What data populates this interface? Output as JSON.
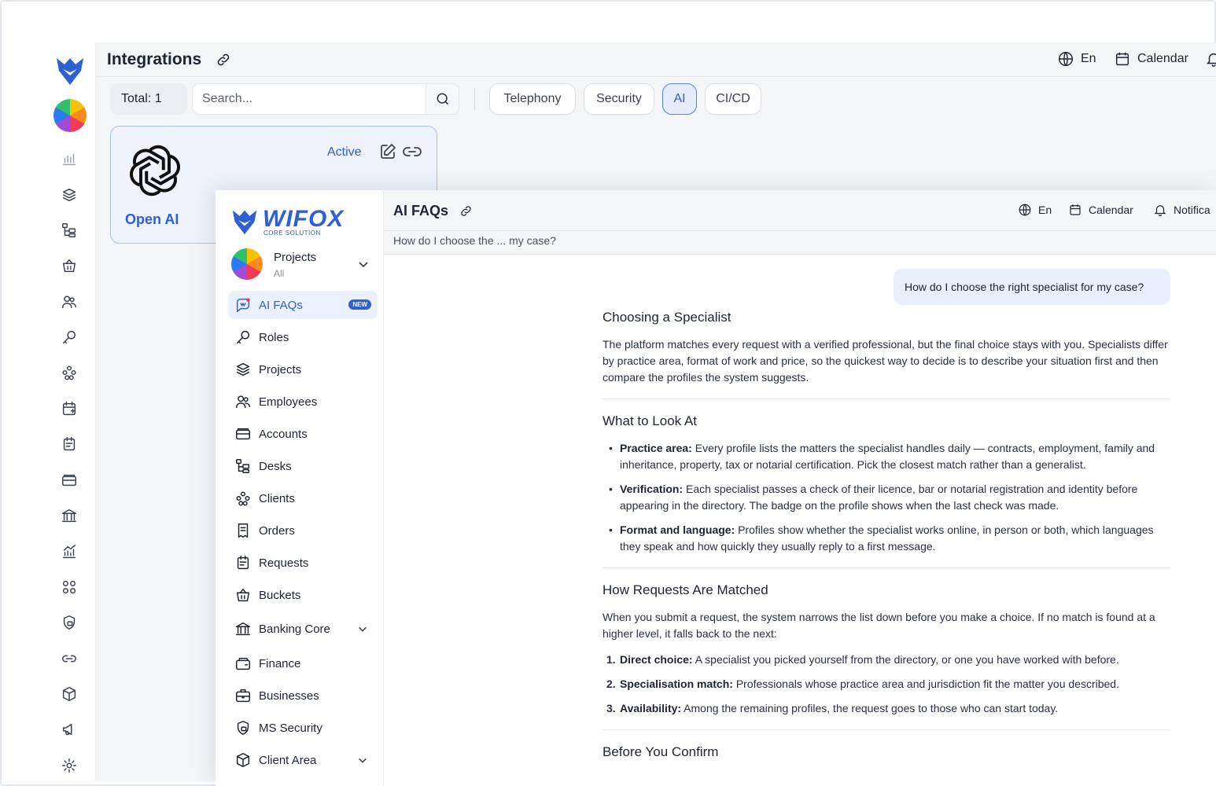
{
  "back": {
    "title": "Integrations",
    "header": {
      "language": "En",
      "calendar": "Calendar"
    },
    "toolbar": {
      "total": "Total: 1",
      "search_placeholder": "Search...",
      "filters": [
        "Telephony",
        "Security",
        "AI",
        "CI/CD"
      ],
      "active_filter": "AI"
    },
    "card": {
      "name": "Open AI",
      "status": "Active"
    }
  },
  "front": {
    "brand": {
      "name": "WIFOX",
      "sub": "CORE SOLUTION"
    },
    "project": {
      "title": "Projects",
      "sub": "All"
    },
    "nav": [
      {
        "label": "AI FAQs",
        "icon": "ai-chat-icon",
        "badge": "NEW",
        "active": true
      },
      {
        "label": "Roles",
        "icon": "key-icon"
      },
      {
        "label": "Projects",
        "icon": "layers-icon"
      },
      {
        "label": "Employees",
        "icon": "users-icon"
      },
      {
        "label": "Accounts",
        "icon": "wallet-icon"
      },
      {
        "label": "Desks",
        "icon": "hierarchy-icon"
      },
      {
        "label": "Clients",
        "icon": "clients-icon"
      },
      {
        "label": "Orders",
        "icon": "orders-icon"
      },
      {
        "label": "Requests",
        "icon": "requests-icon"
      },
      {
        "label": "Buckets",
        "icon": "basket-icon"
      },
      {
        "label": "Banking Core",
        "icon": "bank-icon",
        "expandable": true
      },
      {
        "label": "Finance",
        "icon": "finance-icon"
      },
      {
        "label": "Businesses",
        "icon": "business-icon"
      },
      {
        "label": "MS Security",
        "icon": "shield-lock-icon"
      },
      {
        "label": "Client Area",
        "icon": "box-icon",
        "expandable": true
      }
    ],
    "header": {
      "title": "AI FAQs",
      "language": "En",
      "calendar": "Calendar",
      "notifications": "Notifica"
    },
    "subtitle": "How do I choose the ... my case?",
    "chat": {
      "question": "How do I choose the right specialist for my case?",
      "sections": {
        "s1": {
          "heading": "Choosing a Specialist",
          "body": "The platform matches every request with a verified professional, but the final choice stays with you. Specialists differ by practice area, format of work and price, so the quickest way to decide is to describe your situation first and then compare the profiles the system suggests."
        },
        "s2": {
          "heading": "What to Look At",
          "items": [
            {
              "term": "Practice area:",
              "text": " Every profile lists the matters the specialist handles daily — contracts, employment, family and inheritance, property, tax or notarial certification. Pick the closest match rather than a generalist."
            },
            {
              "term": "Verification:",
              "text": " Each specialist passes a check of their licence, bar or notarial registration and identity before appearing in the directory. The badge on the profile shows when the last check was made."
            },
            {
              "term": "Format and language:",
              "text": " Profiles show whether the specialist works online, in person or both, which languages they speak and how quickly they usually reply to a first message."
            }
          ]
        },
        "s3": {
          "heading": "How Requests Are Matched",
          "body": "When you submit a request, the system narrows the list down before you make a choice. If no match is found at a higher level, it falls back to the next:",
          "items": [
            {
              "num": "1.",
              "term": "Direct choice:",
              "text": " A specialist you picked yourself from the directory, or one you have worked with before."
            },
            {
              "num": "2.",
              "term": "Specialisation match:",
              "text": " Professionals whose practice area and jurisdiction fit the matter you described."
            },
            {
              "num": "3.",
              "term": "Availability:",
              "text": " Among the remaining profiles, the request goes to those who can start today."
            }
          ]
        },
        "s4": {
          "heading": "Before You Confirm"
        }
      }
    }
  },
  "colors": {
    "accent": "#2e5fd3",
    "accent_bg": "#eaf0fc",
    "header_bg": "#f4f5f7"
  }
}
